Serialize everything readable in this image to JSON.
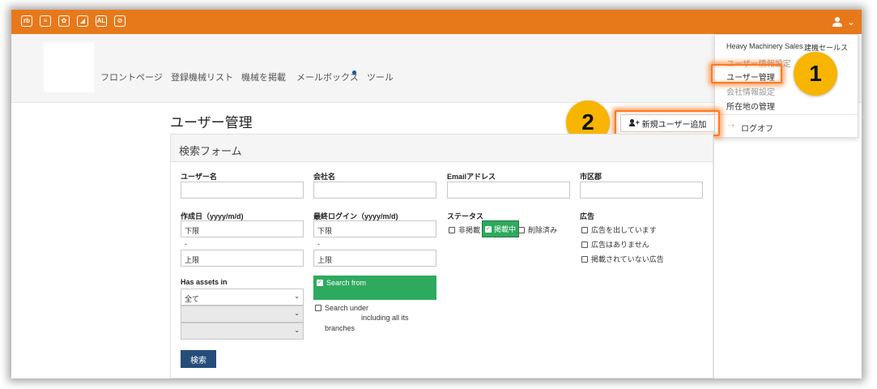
{
  "topbar": {
    "apps": [
      {
        "icon": "rb-app-icon",
        "glyph": "rb"
      },
      {
        "icon": "mmm-app-icon",
        "glyph": "≡"
      },
      {
        "icon": "gear-app-icon",
        "glyph": "✿"
      },
      {
        "icon": "chart-app-icon",
        "glyph": "◢"
      },
      {
        "icon": "al-app-icon",
        "glyph": "AL"
      },
      {
        "icon": "tag-app-icon",
        "glyph": "⊘"
      }
    ],
    "user_chevron": "⌄"
  },
  "nav": {
    "links": [
      "フロントページ",
      "登録機械リスト",
      "機械を掲載",
      "メールボックス",
      "ツール"
    ]
  },
  "dropdown": {
    "header_company": "Heavy Machinery Sales",
    "header_user": "建機セールス",
    "items": [
      "ユーザー情報設定",
      "ユーザー管理",
      "会社情報設定",
      "所在地の管理"
    ],
    "logout": "ログオフ"
  },
  "badges": {
    "one": "1",
    "two": "2"
  },
  "page": {
    "title": "ユーザー管理",
    "add_user_label": "新規ユーザー追加"
  },
  "form": {
    "title": "検索フォーム",
    "username_label": "ユーザー名",
    "company_label": "会社名",
    "email_label": "Emailアドレス",
    "city_label": "市区郡",
    "created_label": "作成日（yyyy/m/d)",
    "created_lower": "下限",
    "created_upper": "上限",
    "lastlogin_label": "最終ログイン（yyyy/m/d)",
    "lastlogin_lower": "下限",
    "lastlogin_upper": "上限",
    "range_sep": "-",
    "status_label": "ステータス",
    "status_options": [
      "非掲載",
      "掲載中",
      "削除済み"
    ],
    "ad_label": "広告",
    "ad_options": [
      "広告を出しています",
      "広告はありません",
      "掲載されていない広告"
    ],
    "assets_label": "Has assets in",
    "assets_selected": "全て",
    "search_from": "Search from",
    "search_under": "Search under",
    "including": "including all its",
    "branches": "branches",
    "search_button": "検索"
  },
  "colors": {
    "topbar": "#e8791b",
    "highlight": "#ff7a1f",
    "badge": "#f7b500",
    "green": "#2eaa5f",
    "search_button": "#254d7a"
  }
}
